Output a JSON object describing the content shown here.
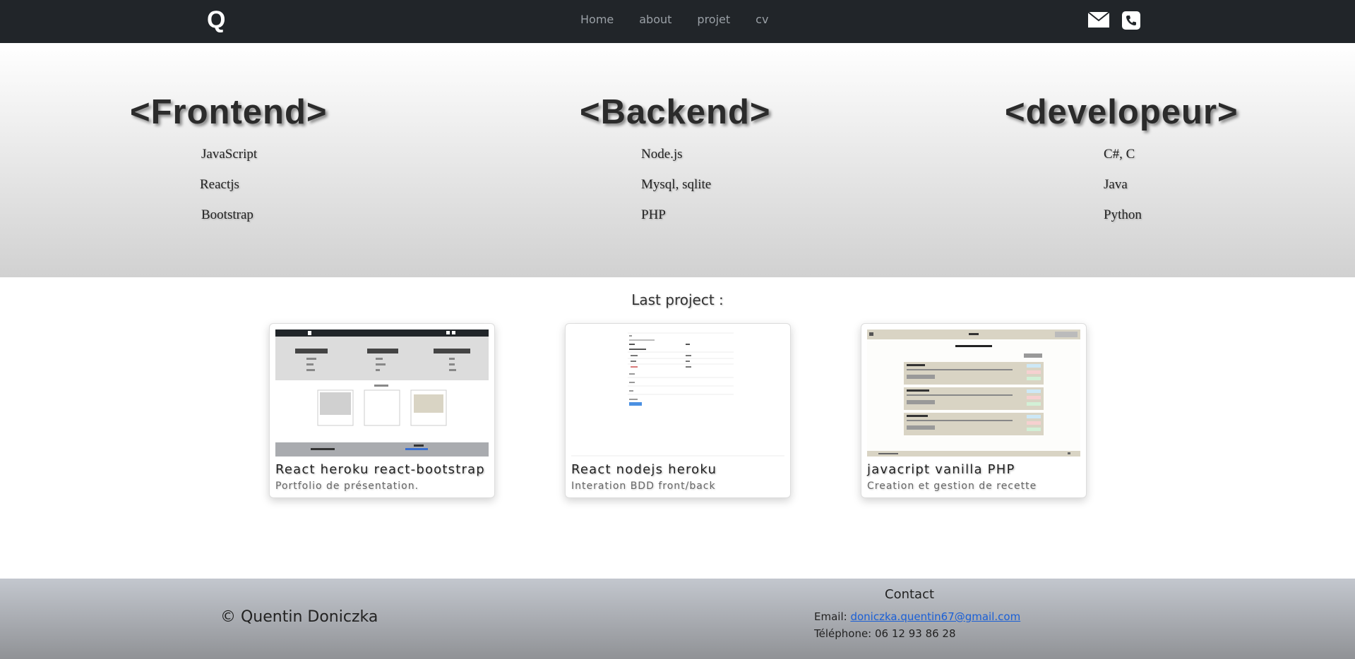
{
  "navbar": {
    "brand": "Q",
    "links": [
      "Home",
      "about",
      "projet",
      "cv"
    ],
    "icons": [
      "mail-icon",
      "phone-icon"
    ]
  },
  "hero": {
    "columns": [
      {
        "title": "<Frontend>",
        "items": [
          "JavaScript",
          "Reactjs",
          "Bootstrap"
        ]
      },
      {
        "title": "<Backend>",
        "items": [
          "Node.js",
          "Mysql, sqlite",
          "PHP"
        ]
      },
      {
        "title": "<developeur>",
        "items": [
          "C#, C",
          "Java",
          "Python"
        ]
      }
    ]
  },
  "projects": {
    "title": "Last project :",
    "cards": [
      {
        "title": "React heroku react-bootstrap",
        "subtitle": "Portfolio de présentation."
      },
      {
        "title": "React nodejs heroku",
        "subtitle": "Interation BDD front/back"
      },
      {
        "title": "javacript vanilla PHP",
        "subtitle": "Creation et gestion de recette"
      }
    ]
  },
  "footer": {
    "copyright": "© Quentin Doniczka",
    "contact_title": "Contact",
    "email_label": "Email: ",
    "email": "doniczka.quentin67@gmail.com",
    "phone_label": "Téléphone: 06 12 93 86 28"
  },
  "colors": {
    "navbar_bg": "#212529",
    "link_blue": "#1a5fd6"
  }
}
